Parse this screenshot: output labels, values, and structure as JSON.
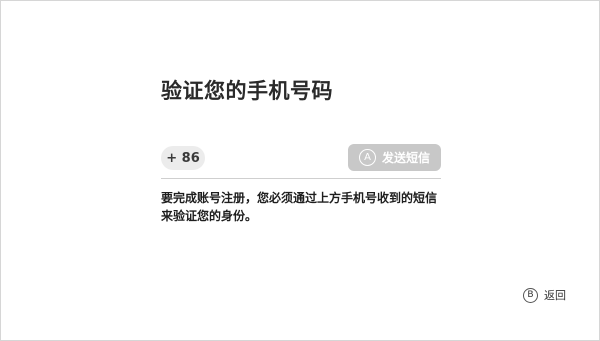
{
  "title": "验证您的手机号码",
  "phone": {
    "country_code": "+ 86"
  },
  "send_button": {
    "badge": "A",
    "label": "发送短信"
  },
  "description": {
    "line1": "要完成账号注册，您必须通过上方手机号收到的短信",
    "line2": "来验证您的身份。"
  },
  "footer": {
    "back_badge": "B",
    "back_label": "返回"
  },
  "colors": {
    "send_button_disabled": "#c8c8c8",
    "country_code_bg": "#ececec",
    "divider": "#cfcfcf"
  }
}
